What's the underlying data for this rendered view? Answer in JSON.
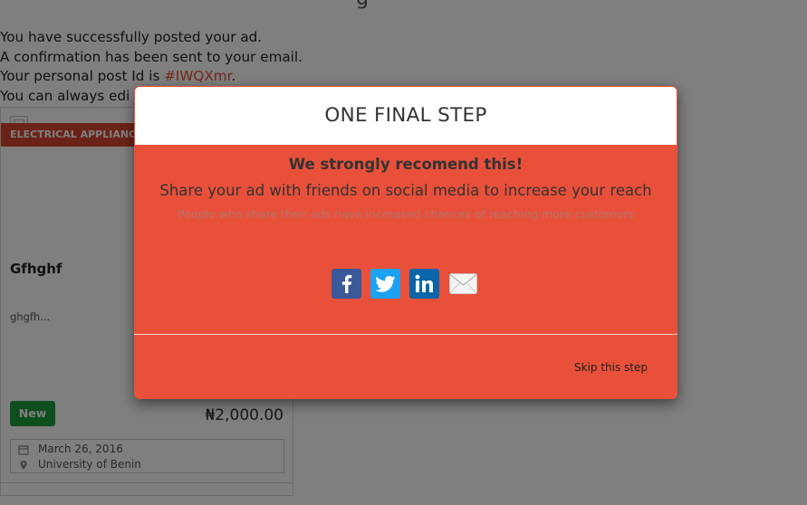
{
  "page": {
    "heading_fragment": "g",
    "confirmation": {
      "line1": "You have successfully posted your ad.",
      "line2": "A confirmation has been sent to your email.",
      "line3_prefix": "Your personal post Id is ",
      "post_id": "#IWQXmr",
      "line3_suffix": ".",
      "line4": "You can always edi"
    }
  },
  "ad_card": {
    "category": "ELECTRICAL APPLIANC",
    "title": "Gfhghf",
    "description": "ghgfh...",
    "condition": "New",
    "price": "₦2,000.00",
    "date": "March 26, 2016",
    "location": "University of Benin"
  },
  "modal": {
    "title": "ONE FINAL STEP",
    "recommend_heading": "We strongly recomend this!",
    "share_message": "Share your ad with friends on social media to increase your reach",
    "share_note": "People who share their ads have increased chances of reaching more customers",
    "share_icons": [
      "facebook-icon",
      "twitter-icon",
      "linkedin-icon",
      "mail-icon"
    ],
    "skip_label": "Skip this step"
  },
  "colors": {
    "modal_bg": "#e8503a",
    "category_ribbon": "#d9472f",
    "condition_badge": "#1f9d3e",
    "link": "#e84e37",
    "facebook": "#3b5998",
    "twitter": "#1da1f2",
    "linkedin": "#0a66a8"
  }
}
